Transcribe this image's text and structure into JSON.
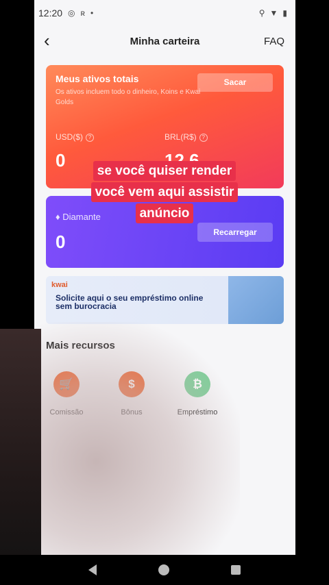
{
  "status": {
    "time": "12:20"
  },
  "header": {
    "title": "Minha carteira",
    "faq": "FAQ"
  },
  "assets": {
    "title": "Meus ativos totais",
    "description": "Os ativos incluem todo o dinheiro, Koins e Kwai Golds",
    "withdraw_label": "Sacar",
    "usd_label": "USD($)",
    "usd_value": "0",
    "brl_label": "BRL(R$)",
    "brl_value": "12,6"
  },
  "diamond": {
    "label": "Diamante",
    "value": "0",
    "recharge_label": "Recarregar"
  },
  "banner": {
    "brand": "kwai",
    "text": "Solicite aqui o seu empréstimo online sem burocracia"
  },
  "more": {
    "title": "Mais recursos",
    "items": [
      {
        "label": "Comissão",
        "icon": "cart-icon",
        "color": "#f25a1e"
      },
      {
        "label": "Bônus",
        "icon": "money-bag-icon",
        "color": "#f25a1e"
      },
      {
        "label": "Empréstimo",
        "icon": "cash-icon",
        "color": "#3fa86b"
      }
    ]
  },
  "caption": {
    "lines": [
      "se você quiser render",
      "você vem aqui assistir",
      "anúncio"
    ]
  },
  "colors": {
    "assets_gradient_start": "#ff8a5a",
    "assets_gradient_end": "#f23b5a",
    "diamond_gradient": "#6c45f6",
    "caption_bg": "#e8304a"
  }
}
